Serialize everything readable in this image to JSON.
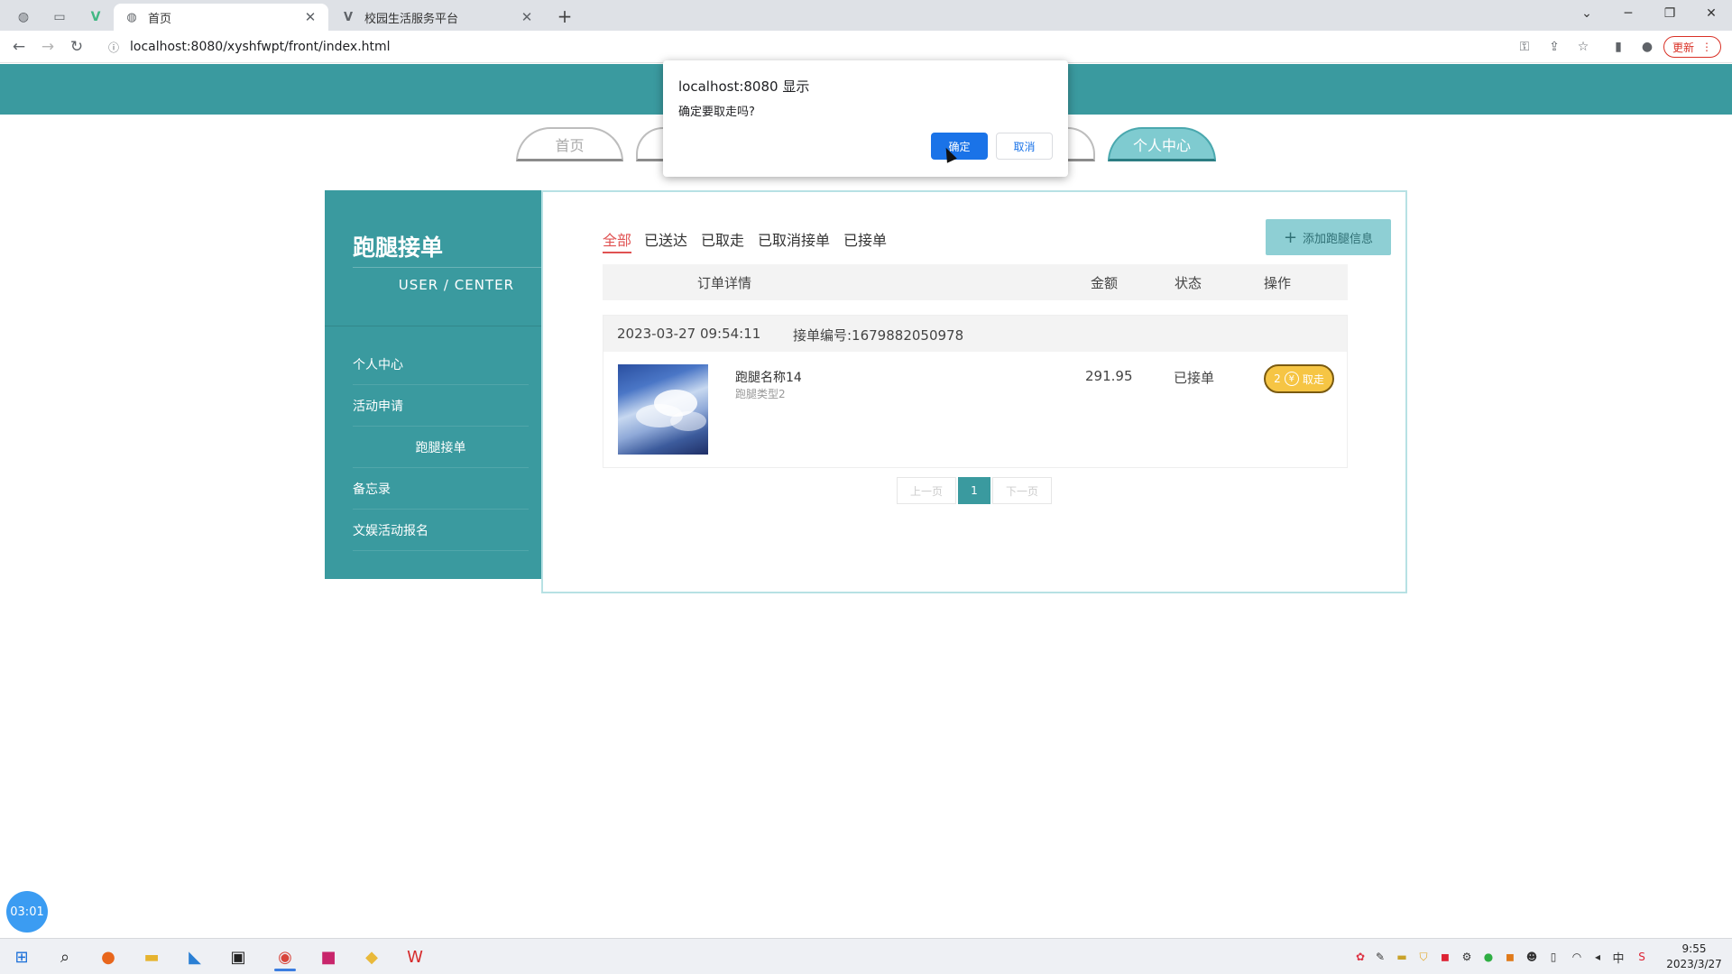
{
  "browser": {
    "tabs": [
      {
        "title": "首页",
        "icon": "globe-icon"
      },
      {
        "title": "校园生活服务平台",
        "icon": "vue-logo-icon"
      }
    ],
    "url": "localhost:8080/xyshfwpt/front/index.html",
    "update_label": "更新"
  },
  "nav": {
    "items": [
      "首页",
      "个人中心"
    ]
  },
  "sidebar": {
    "title": "跑腿接单",
    "subtitle": "USER / CENTER",
    "items": [
      "个人中心",
      "活动申请",
      "跑腿接单",
      "备忘录",
      "文娱活动报名"
    ]
  },
  "filters": [
    "全部",
    "已送达",
    "已取走",
    "已取消接单",
    "已接单"
  ],
  "add_button": "添加跑腿信息",
  "table_headers": {
    "detail": "订单详情",
    "amount": "金额",
    "status": "状态",
    "action": "操作"
  },
  "order": {
    "time": "2023-03-27 09:54:11",
    "number": "接单编号:1679882050978",
    "name": "跑腿名称14",
    "type": "跑腿类型2",
    "amount": "291.95",
    "status": "已接单",
    "action_prefix": "2",
    "action_label": "取走"
  },
  "pagination": {
    "prev": "上一页",
    "current": "1",
    "next": "下一页"
  },
  "dialog": {
    "title": "localhost:8080 显示",
    "message": "确定要取走吗?",
    "ok": "确定",
    "cancel": "取消"
  },
  "timer": "03:01",
  "clock": {
    "time": "9:55",
    "date": "2023/3/27"
  },
  "taskbar": {
    "ime": "中"
  }
}
